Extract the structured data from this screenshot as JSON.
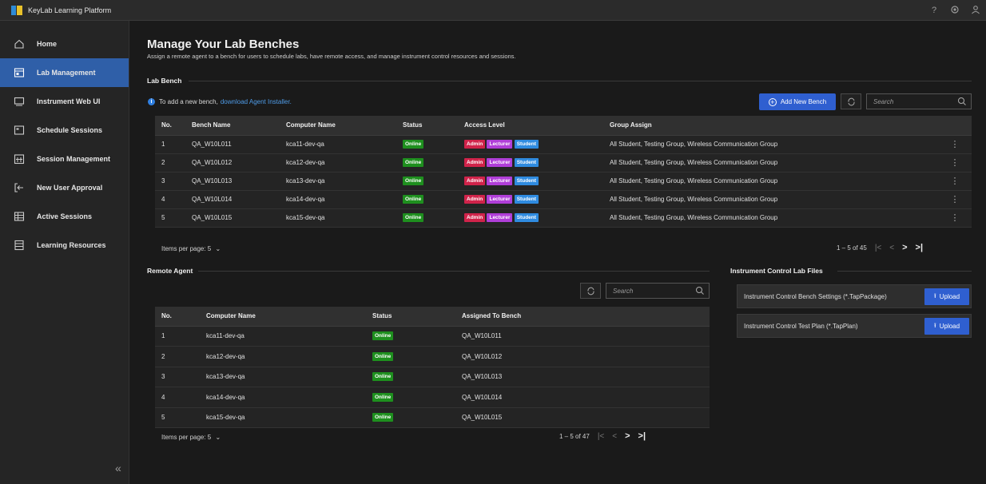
{
  "app": {
    "title": "KeyLab Learning Platform"
  },
  "topbar": {
    "icons": [
      "help-icon",
      "settings-icon",
      "user-icon"
    ],
    "help_glyph": "?"
  },
  "sidebar": {
    "items": [
      {
        "label": "Home",
        "icon": "home-icon",
        "active": false
      },
      {
        "label": "Lab Management",
        "icon": "lab-management-icon",
        "active": true
      },
      {
        "label": "Instrument Web UI",
        "icon": "monitor-icon",
        "active": false
      },
      {
        "label": "Schedule Sessions",
        "icon": "schedule-icon",
        "active": false
      },
      {
        "label": "Session Management",
        "icon": "calendar-icon",
        "active": false
      },
      {
        "label": "New User Approval",
        "icon": "login-icon",
        "active": false
      },
      {
        "label": "Active Sessions",
        "icon": "grid-icon",
        "active": false
      },
      {
        "label": "Learning Resources",
        "icon": "resources-icon",
        "active": false
      }
    ],
    "collapse_glyph": "«"
  },
  "page": {
    "title": "Manage Your Lab Benches",
    "subtitle": "Assign a remote agent to a bench for users to schedule labs, have remote access, and manage instrument control resources and sessions."
  },
  "lab_bench": {
    "section_label": "Lab Bench",
    "info_text": "To add a new bench,",
    "info_link": "download Agent Installer.",
    "add_button": "Add New Bench",
    "search_placeholder": "Search",
    "columns": [
      "No.",
      "Bench Name",
      "Computer Name",
      "Status",
      "Access Level",
      "Group Assign"
    ],
    "rows": [
      {
        "no": "1",
        "bench": "QA_W10L011",
        "computer": "kca11-dev-qa",
        "status": "Online",
        "access": [
          "Admin",
          "Lecturer",
          "Student"
        ],
        "group": "All Student, Testing Group, Wireless Communication Group"
      },
      {
        "no": "2",
        "bench": "QA_W10L012",
        "computer": "kca12-dev-qa",
        "status": "Online",
        "access": [
          "Admin",
          "Lecturer",
          "Student"
        ],
        "group": "All Student, Testing Group, Wireless Communication Group"
      },
      {
        "no": "3",
        "bench": "QA_W10L013",
        "computer": "kca13-dev-qa",
        "status": "Online",
        "access": [
          "Admin",
          "Lecturer",
          "Student"
        ],
        "group": "All Student, Testing Group, Wireless Communication Group"
      },
      {
        "no": "4",
        "bench": "QA_W10L014",
        "computer": "kca14-dev-qa",
        "status": "Online",
        "access": [
          "Admin",
          "Lecturer",
          "Student"
        ],
        "group": "All Student, Testing Group, Wireless Communication Group"
      },
      {
        "no": "5",
        "bench": "QA_W10L015",
        "computer": "kca15-dev-qa",
        "status": "Online",
        "access": [
          "Admin",
          "Lecturer",
          "Student"
        ],
        "group": "All Student, Testing Group, Wireless Communication Group"
      }
    ],
    "items_per_page": "Items per page:  5",
    "range": "1 – 5 of 45"
  },
  "remote_agent": {
    "section_label": "Remote Agent",
    "search_placeholder": "Search",
    "columns": [
      "No.",
      "Computer Name",
      "Status",
      "Assigned To Bench"
    ],
    "rows": [
      {
        "no": "1",
        "computer": "kca11-dev-qa",
        "status": "Online",
        "bench": "QA_W10L011"
      },
      {
        "no": "2",
        "computer": "kca12-dev-qa",
        "status": "Online",
        "bench": "QA_W10L012"
      },
      {
        "no": "3",
        "computer": "kca13-dev-qa",
        "status": "Online",
        "bench": "QA_W10L013"
      },
      {
        "no": "4",
        "computer": "kca14-dev-qa",
        "status": "Online",
        "bench": "QA_W10L014"
      },
      {
        "no": "5",
        "computer": "kca15-dev-qa",
        "status": "Online",
        "bench": "QA_W10L015"
      }
    ],
    "items_per_page": "Items per page:  5",
    "range": "1 – 5 of 47"
  },
  "instrument_files": {
    "section_label": "Instrument Control Lab Files",
    "files": [
      {
        "label": "Instrument Control Bench Settings (*.TapPackage)",
        "button": "Upload"
      },
      {
        "label": "Instrument Control Test Plan (*.TapPlan)",
        "button": "Upload"
      }
    ]
  },
  "colors": {
    "accent": "#2f5fd0",
    "online": "#1e8f1e",
    "admin": "#d0234a",
    "lecturer": "#b03ed8",
    "student": "#2f8be0",
    "active_nav": "#2f5fa8"
  }
}
